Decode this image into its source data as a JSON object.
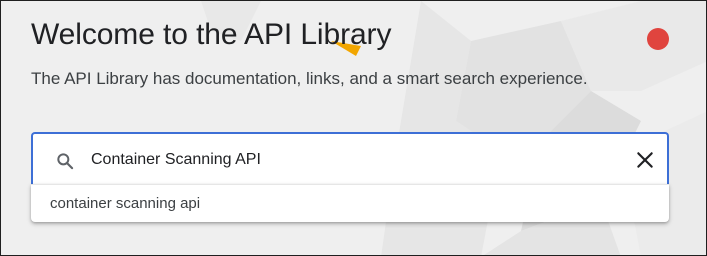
{
  "header": {
    "title": "Welcome to the API Library",
    "subtitle": "The API Library has documentation, links, and a smart search experience."
  },
  "recording_indicator": {
    "color": "#e0443e"
  },
  "search": {
    "icon": "search-icon",
    "value": "Container Scanning API",
    "clear_icon": "close-icon",
    "accent_color": "#3d6fd6"
  },
  "suggestions": [
    {
      "label": "container scanning api"
    }
  ]
}
